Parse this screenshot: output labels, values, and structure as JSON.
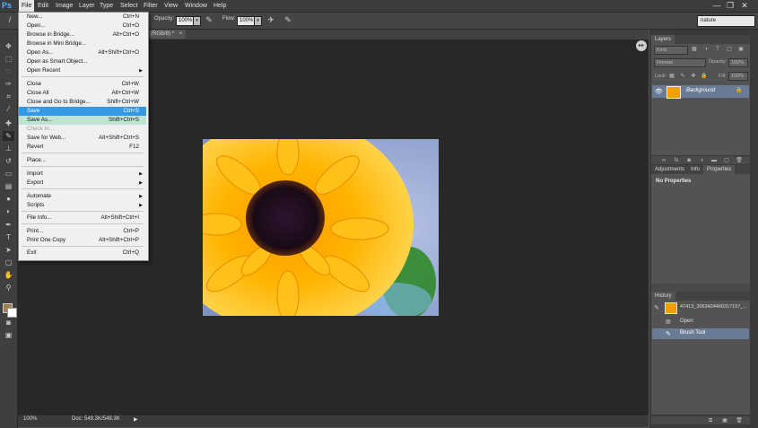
{
  "app": {
    "logo": "Ps"
  },
  "menubar": {
    "items": [
      "File",
      "Edit",
      "Image",
      "Layer",
      "Type",
      "Select",
      "Filter",
      "View",
      "Window",
      "Help"
    ],
    "window_buttons": [
      "—",
      "❐",
      "✕"
    ]
  },
  "options": {
    "opacity_label": "Opacity:",
    "opacity_value": "100%",
    "flow_label": "Flow:",
    "flow_value": "100%",
    "workspace": "nature"
  },
  "document": {
    "tab_title": "(RGB/8) *",
    "tab_close": "×"
  },
  "status": {
    "zoom": "100%",
    "doc": "Doc: 549.3K/549.3K"
  },
  "file_menu": {
    "items": [
      {
        "label": "New...",
        "shortcut": "Ctrl+N"
      },
      {
        "label": "Open...",
        "shortcut": "Ctrl+O"
      },
      {
        "label": "Browse in Bridge...",
        "shortcut": "Alt+Ctrl+O"
      },
      {
        "label": "Browse in Mini Bridge...",
        "shortcut": ""
      },
      {
        "label": "Open As...",
        "shortcut": "Alt+Shift+Ctrl+O"
      },
      {
        "label": "Open as Smart Object...",
        "shortcut": ""
      },
      {
        "label": "Open Recent",
        "shortcut": ""
      },
      {
        "label": "Close",
        "shortcut": "Ctrl+W"
      },
      {
        "label": "Close All",
        "shortcut": "Alt+Ctrl+W"
      },
      {
        "label": "Close and Go to Bridge...",
        "shortcut": "Shift+Ctrl+W"
      },
      {
        "label": "Save",
        "shortcut": "Ctrl+S"
      },
      {
        "label": "Save As...",
        "shortcut": "Shift+Ctrl+S"
      },
      {
        "label": "Check In...",
        "shortcut": ""
      },
      {
        "label": "Save for Web...",
        "shortcut": "Alt+Shift+Ctrl+S"
      },
      {
        "label": "Revert",
        "shortcut": "F12"
      },
      {
        "label": "Place...",
        "shortcut": ""
      },
      {
        "label": "Import",
        "shortcut": ""
      },
      {
        "label": "Export",
        "shortcut": ""
      },
      {
        "label": "Automate",
        "shortcut": ""
      },
      {
        "label": "Scripts",
        "shortcut": ""
      },
      {
        "label": "File Info...",
        "shortcut": "Alt+Shift+Ctrl+I"
      },
      {
        "label": "Print...",
        "shortcut": "Ctrl+P"
      },
      {
        "label": "Print One Copy",
        "shortcut": "Alt+Shift+Ctrl+P"
      },
      {
        "label": "Exit",
        "shortcut": "Ctrl+Q"
      }
    ]
  },
  "layers_panel": {
    "tab": "Layers",
    "kind": "Kind",
    "blend": "Normal",
    "opacity_label": "Opacity:",
    "opacity_value": "100%",
    "lock_label": "Lock:",
    "fill_label": "Fill:",
    "fill_value": "100%",
    "layer_name": "Background"
  },
  "properties_panel": {
    "tabs": [
      "Adjustments",
      "Info",
      "Properties"
    ],
    "message": "No Properties"
  },
  "history_panel": {
    "tab": "History",
    "snapshot": "47413_3063424460317197_...",
    "steps": [
      "Open",
      "Brush Tool"
    ]
  },
  "colors": {
    "menu_highlight": "#3399e6",
    "menu_highlight_secondary": "#bfe3d2",
    "layer_selected": "#6a7c95",
    "logo": "#4fb0ff"
  }
}
